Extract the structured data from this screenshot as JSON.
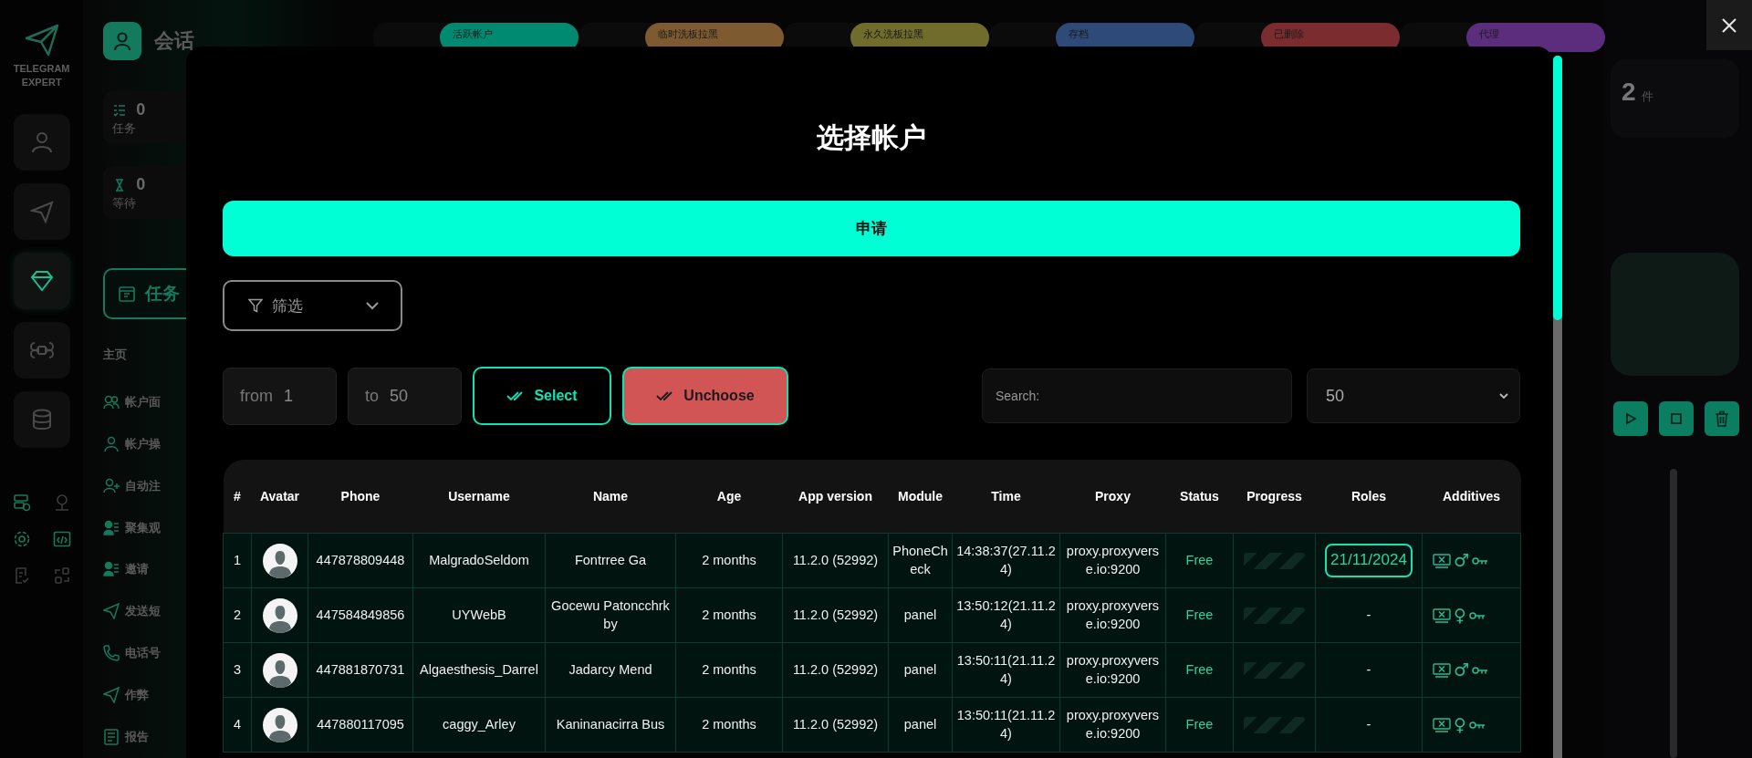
{
  "app": {
    "logo_text": "TELEGRAM EXPERT",
    "rail_items": [
      {
        "selected": false
      },
      {
        "selected": false
      },
      {
        "selected": true
      },
      {
        "selected": false
      },
      {
        "selected": false
      }
    ],
    "page_title": "会话",
    "stats": [
      {
        "value": "0",
        "label": "任务"
      },
      {
        "value": "0",
        "label": "等待"
      }
    ],
    "task_button": "任务",
    "section_label": "主页",
    "nav_items": [
      "帐户面",
      "帐户操",
      "自动注",
      "聚集观",
      "邀请",
      "发送短",
      "电话号",
      "作弊",
      "报告"
    ],
    "status_tags": [
      {
        "label": "活跃帐户",
        "color": "#008a72"
      },
      {
        "label": "临时洗板拉黑",
        "color": "#7d5a30"
      },
      {
        "label": "永久洗板拉黑",
        "color": "#6f6c2c"
      },
      {
        "label": "存档",
        "color": "#2d4a78"
      },
      {
        "label": "已删除",
        "color": "#7a2c2e"
      },
      {
        "label": "代理",
        "color": "#5c2d7c"
      }
    ],
    "count": {
      "value": "2",
      "unit": "件"
    }
  },
  "modal": {
    "title": "选择帐户",
    "apply_button": "申请",
    "filter": {
      "label": "筛选"
    },
    "range": {
      "from_label": "from",
      "from_value": "1",
      "to_label": "to",
      "to_value": "50"
    },
    "select_button": "Select",
    "unchoose_button": "Unchoose",
    "search": {
      "placeholder": "Search:"
    },
    "page_size": "50",
    "table": {
      "columns": [
        "#",
        "Avatar",
        "Phone",
        "Username",
        "Name",
        "Age",
        "App version",
        "Module",
        "Time",
        "Proxy",
        "Status",
        "Progress",
        "Roles",
        "Additives"
      ],
      "rows": [
        {
          "index": "1",
          "phone": "447878809448",
          "username": "MalgradoSeldom",
          "name": "Fontrree Ga",
          "age": "2 months",
          "app_version": "11.2.0 (52992)",
          "module": "PhoneCheck",
          "time": "14:38:37(27.11.24)",
          "proxy": "proxy.proxyverse.io:9200",
          "status": "Free",
          "progress": {
            "level": 0
          },
          "roles": {
            "kind": "date",
            "text": "21/11/2024"
          },
          "gender_symbol": "♂"
        },
        {
          "index": "2",
          "phone": "447584849856",
          "username": "UYWebB",
          "name": "Gocewu Patoncchrkby",
          "age": "2 months",
          "app_version": "11.2.0 (52992)",
          "module": "panel",
          "time": "13:50:12(21.11.24)",
          "proxy": "proxy.proxyverse.io:9200",
          "status": "Free",
          "progress": {
            "level": 0
          },
          "roles": {
            "kind": "plain",
            "text": "-"
          },
          "gender_symbol": "♀"
        },
        {
          "index": "3",
          "phone": "447881870731",
          "username": "Algaesthesis_Darrel",
          "name": "Jadarcy Mend",
          "age": "2 months",
          "app_version": "11.2.0 (52992)",
          "module": "panel",
          "time": "13:50:11(21.11.24)",
          "proxy": "proxy.proxyverse.io:9200",
          "status": "Free",
          "progress": {
            "level": 0
          },
          "roles": {
            "kind": "plain",
            "text": "-"
          },
          "gender_symbol": "♂"
        },
        {
          "index": "4",
          "phone": "447880117095",
          "username": "caggy_Arley",
          "name": "Kaninanacirra Bus",
          "age": "2 months",
          "app_version": "11.2.0 (52992)",
          "module": "panel",
          "time": "13:50:11(21.11.24)",
          "proxy": "proxy.proxyverse.io:9200",
          "status": "Free",
          "progress": {
            "level": 0
          },
          "roles": {
            "kind": "plain",
            "text": "-"
          },
          "gender_symbol": "♀"
        }
      ]
    }
  }
}
